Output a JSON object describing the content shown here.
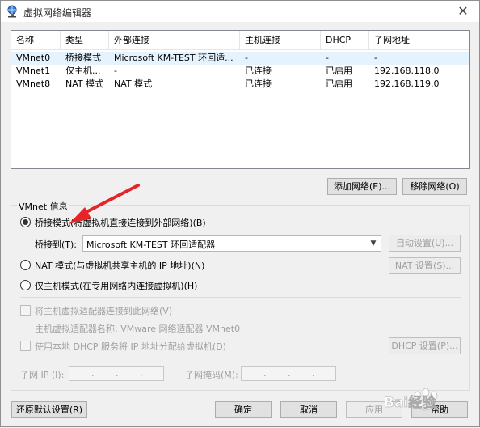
{
  "window": {
    "title": "虚拟网络编辑器",
    "close": "✕"
  },
  "columns": [
    "名称",
    "类型",
    "外部连接",
    "主机连接",
    "DHCP",
    "子网地址"
  ],
  "rows": [
    [
      "VMnet0",
      "桥接模式",
      "Microsoft KM-TEST 环回适...",
      "-",
      "-",
      "-"
    ],
    [
      "VMnet1",
      "仅主机...",
      "-",
      "已连接",
      "已启用",
      "192.168.118.0"
    ],
    [
      "VMnet8",
      "NAT 模式",
      "NAT 模式",
      "已连接",
      "已启用",
      "192.168.119.0"
    ]
  ],
  "buttons": {
    "add_network": "添加网络(E)...",
    "remove_network": "移除网络(O)",
    "auto_settings": "自动设置(U)...",
    "nat_settings": "NAT 设置(S)...",
    "dhcp_settings": "DHCP 设置(P)...",
    "restore_defaults": "还原默认设置(R)",
    "ok": "确定",
    "cancel": "取消",
    "apply": "应用",
    "help": "帮助"
  },
  "vmnet_info": {
    "legend": "VMnet 信息",
    "bridged_label": "桥接模式(将虚拟机直接连接到外部网络)(B)",
    "bridge_to_label": "桥接到(T):",
    "bridge_to_value": "Microsoft KM-TEST 环回适配器",
    "nat_label": "NAT 模式(与虚拟机共享主机的 IP 地址)(N)",
    "hostonly_label": "仅主机模式(在专用网络内连接虚拟机)(H)",
    "connect_adapter_label": "将主机虚拟适配器连接到此网络(V)",
    "adapter_name_label": "主机虚拟适配器名称: VMware 网络适配器 VMnet0",
    "use_dhcp_label": "使用本地 DHCP 服务将 IP 地址分配给虚拟机(D)",
    "subnet_ip_label": "子网 IP (I):",
    "subnet_mask_label": "子网掩码(M):",
    "ip_dots": ".",
    "selected_mode": "bridged"
  },
  "watermark": {
    "text": "Bai经验"
  },
  "colors": {
    "annotation_arrow": "#e4262b",
    "selected_row": "#e5f3ff"
  }
}
